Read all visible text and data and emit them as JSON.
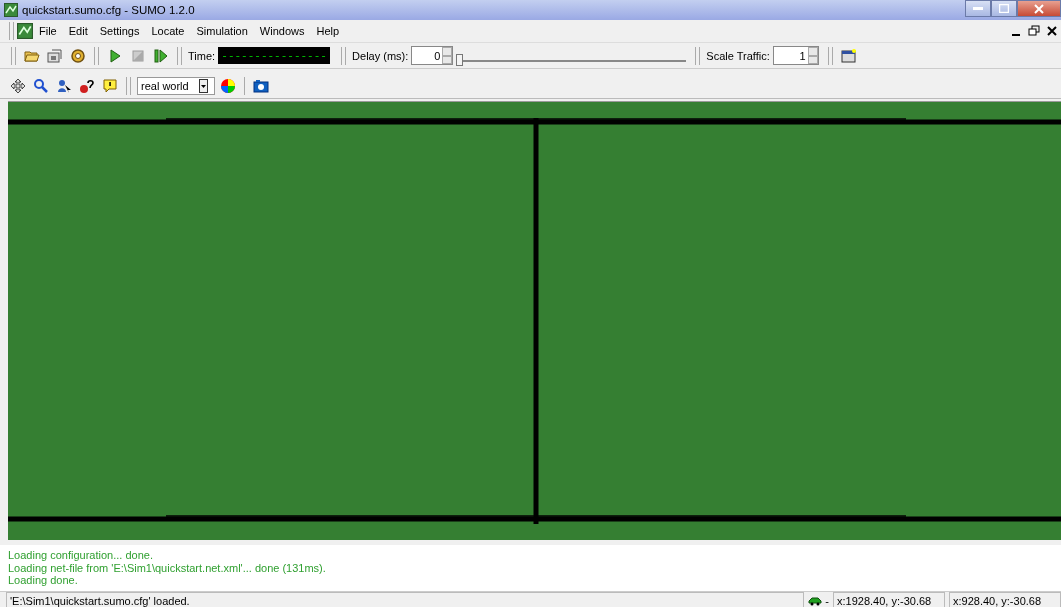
{
  "window": {
    "title": "quickstart.sumo.cfg - SUMO 1.2.0"
  },
  "menu": [
    "File",
    "Edit",
    "Settings",
    "Locate",
    "Simulation",
    "Windows",
    "Help"
  ],
  "toolbar": {
    "time_label": "Time:",
    "time_display": "----------------",
    "delay_label": "Delay (ms):",
    "delay_value": "0",
    "delay_slider": {
      "level": 0
    },
    "scale_label": "Scale Traffic:",
    "scale_value": "1"
  },
  "view_toolbar": {
    "scheme": "real world"
  },
  "messages": [
    "Loading configuration... done.",
    "Loading net-file from 'E:\\Sim1\\quickstart.net.xml'... done (131ms).",
    "Loading done."
  ],
  "status_bar": {
    "message": "'E:\\Sim1\\quickstart.sumo.cfg' loaded.",
    "vehicle_label": "-",
    "coords": [
      "x:1928.40, y:-30.68",
      "x:928.40, y:-30.68"
    ]
  }
}
